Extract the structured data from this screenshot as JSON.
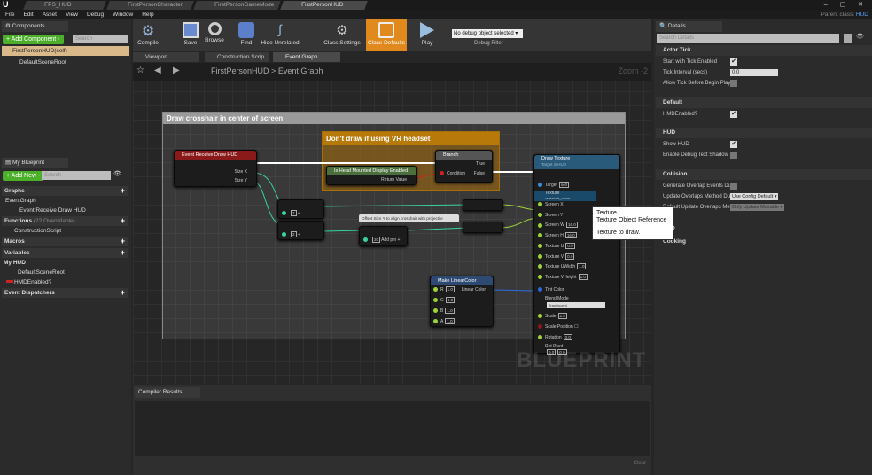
{
  "file_tabs": [
    "FPS_HUD",
    "FirstPersonCharacter",
    "FirstPersonGameMode",
    "FirstPersonHUD"
  ],
  "menu": [
    "File",
    "Edit",
    "Asset",
    "View",
    "Debug",
    "Window",
    "Help"
  ],
  "parent_class": {
    "label": "Parent class:",
    "value": "HUD"
  },
  "components": {
    "title": "Components",
    "add_label": "+ Add Component -",
    "search_placeholder": "Search",
    "items": [
      "FirstPersonHUD(self)",
      "DefaultSceneRoot"
    ]
  },
  "my_blueprint": {
    "title": "My Blueprint",
    "add_label": "+ Add New -",
    "search_placeholder": "Search",
    "graphs": "Graphs",
    "event_graph": "EventGraph",
    "event_receive": "Event Receive Draw HUD",
    "functions": "Functions",
    "functions_count": "(22 Overridable)",
    "construction": "ConstructionScript",
    "macros": "Macros",
    "variables": "Variables",
    "my_hud": "My HUD",
    "default_root": "DefaultSceneRoot",
    "hmd": "HMDEnabled?",
    "dispatchers": "Event Dispatchers"
  },
  "toolbar": {
    "compile": "Compile",
    "save": "Save",
    "browse": "Browse",
    "find": "Find",
    "hide_unrelated": "Hide Unrelated",
    "class_settings": "Class Settings",
    "class_defaults": "Class Defaults",
    "play": "Play",
    "debug_select": "No debug object selected",
    "debug_filter": "Debug Filter"
  },
  "editor_tabs": [
    "Viewport",
    "Construction Scrip",
    "Event Graph"
  ],
  "breadcrumb": {
    "root": "FirstPersonHUD",
    "sep": ">",
    "current": "Event Graph",
    "zoom": "Zoom -2"
  },
  "graph": {
    "comment_main": "Draw crosshair in center of screen",
    "comment_vr": "Don't draw if using VR headset",
    "event_node": {
      "title": "Event Receive Draw HUD",
      "size_x": "Size X",
      "size_y": "Size Y"
    },
    "hmd_node": {
      "title": "Is Head Mounted Display Enabled",
      "ret": "Return Value"
    },
    "branch": {
      "title": "Branch",
      "condition": "Condition",
      "true": "True",
      "false": "False"
    },
    "divide_values": [
      "2",
      "2"
    ],
    "add_node": {
      "value": "20",
      "add_pin": "Add pin"
    },
    "offset_comment": "Offset Size Y to align crosshair with projectile",
    "make_color": {
      "title": "Make LinearColor",
      "pins": [
        {
          "n": "R",
          "v": "1.0"
        },
        {
          "n": "G",
          "v": "1.0"
        },
        {
          "n": "B",
          "v": "1.0"
        },
        {
          "n": "A",
          "v": "1.0"
        }
      ],
      "out": "Linear Color"
    },
    "draw_texture": {
      "title": "Draw Texture",
      "subtitle": "Target is HUD",
      "target": "Target",
      "target_val": "self",
      "texture": "Texture",
      "texture_val": "crosshair_noom",
      "pins": [
        {
          "n": "Screen X",
          "v": ""
        },
        {
          "n": "Screen Y",
          "v": ""
        },
        {
          "n": "Screen W",
          "v": "16.0"
        },
        {
          "n": "Screen H",
          "v": "16.0"
        },
        {
          "n": "Texture U",
          "v": "0.0"
        },
        {
          "n": "Texture V",
          "v": "0.0"
        },
        {
          "n": "Texture UWidth",
          "v": "1.0"
        },
        {
          "n": "Texture VHeight",
          "v": "1.0"
        }
      ],
      "tint": "Tint Color",
      "blend_mode": "Blend Mode",
      "blend_val": "Translucent",
      "scale": "Scale",
      "scale_val": "2.5",
      "scale_pos": "Scale Position",
      "rotation": "Rotation",
      "rotation_val": "0.0",
      "rot_pivot": "Rot Pivot",
      "pivot_x": "0.0",
      "pivot_y": "0.0"
    },
    "tooltip": {
      "line1": "Texture",
      "line2": "Texture Object Reference",
      "line3": "Texture to draw."
    },
    "watermark": "BLUEPRINT"
  },
  "compiler": {
    "title": "Compiler Results",
    "clear": "Clear"
  },
  "details": {
    "title": "Details",
    "search_placeholder": "Search Details",
    "actor_tick": "Actor Tick",
    "start_tick": "Start with Tick Enabled",
    "tick_interval": "Tick Interval (secs)",
    "tick_interval_val": "0.0",
    "allow_tick": "Allow Tick Before Begin Play",
    "default": "Default",
    "hmd": "HMDEnabled?",
    "hud": "HUD",
    "show_hud": "Show HUD",
    "debug_shadow": "Enable Debug Text Shadow",
    "collision": "Collision",
    "gen_overlap": "Generate Overlap Events Dur",
    "update_overlap": "Update Overlaps Method Dur",
    "update_overlap_val": "Use Config Default",
    "default_update": "Default Update Overlaps Met",
    "default_update_val": "Only Update Movable",
    "lod": "LOD",
    "cooking": "Cooking"
  }
}
